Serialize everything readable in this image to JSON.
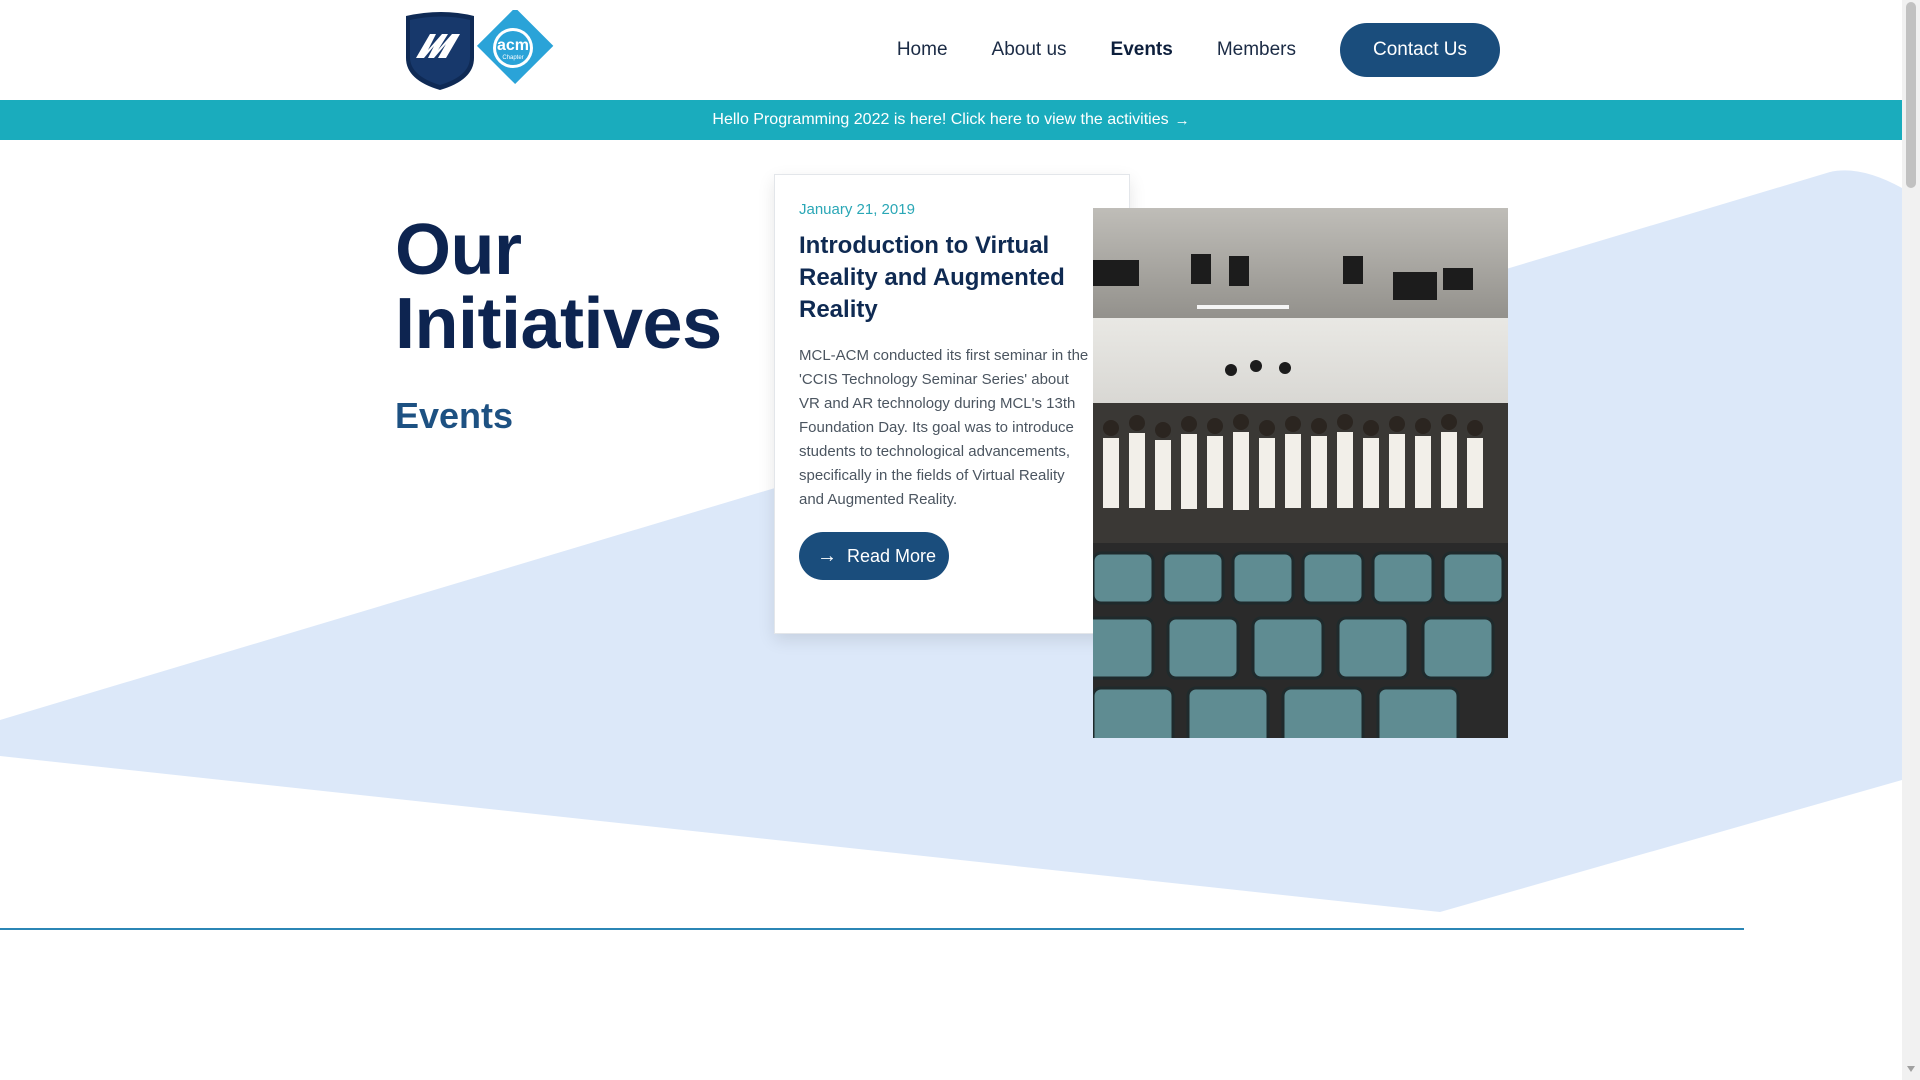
{
  "brand": {
    "logo_left_icon": "mcl-shield-logo",
    "logo_right_text": "acm",
    "logo_right_subtext": "Chapter"
  },
  "nav": {
    "items": [
      {
        "label": "Home",
        "active": false
      },
      {
        "label": "About us",
        "active": false
      },
      {
        "label": "Events",
        "active": true
      },
      {
        "label": "Members",
        "active": false
      }
    ],
    "contact_label": "Contact Us"
  },
  "announcement": {
    "text": "Hello Programming 2022 is here! Click here to view the activities",
    "arrow_icon": "arrow-right-icon"
  },
  "hero": {
    "title_line1": "Our",
    "title_line2": "Initiatives",
    "subtitle": "Events"
  },
  "event": {
    "date": "January 21, 2019",
    "title": "Introduction to Virtual Reality and Augmented Reality",
    "description": "MCL-ACM conducted its first seminar in the 'CCIS Technology Seminar Series' about VR and AR technology during MCL's 13th Foundation Day. Its goal was to introduce students to technological advancements, specifically in the fields of Virtual Reality and Augmented Reality.",
    "button_label": "Read More",
    "button_icon": "arrow-right-icon",
    "photo": "group-photo-in-auditorium"
  },
  "colors": {
    "primary": "#1a4d7c",
    "dark_navy": "#0d2450",
    "teal": "#1aacbd",
    "bg_shape": "#dce8f9"
  }
}
